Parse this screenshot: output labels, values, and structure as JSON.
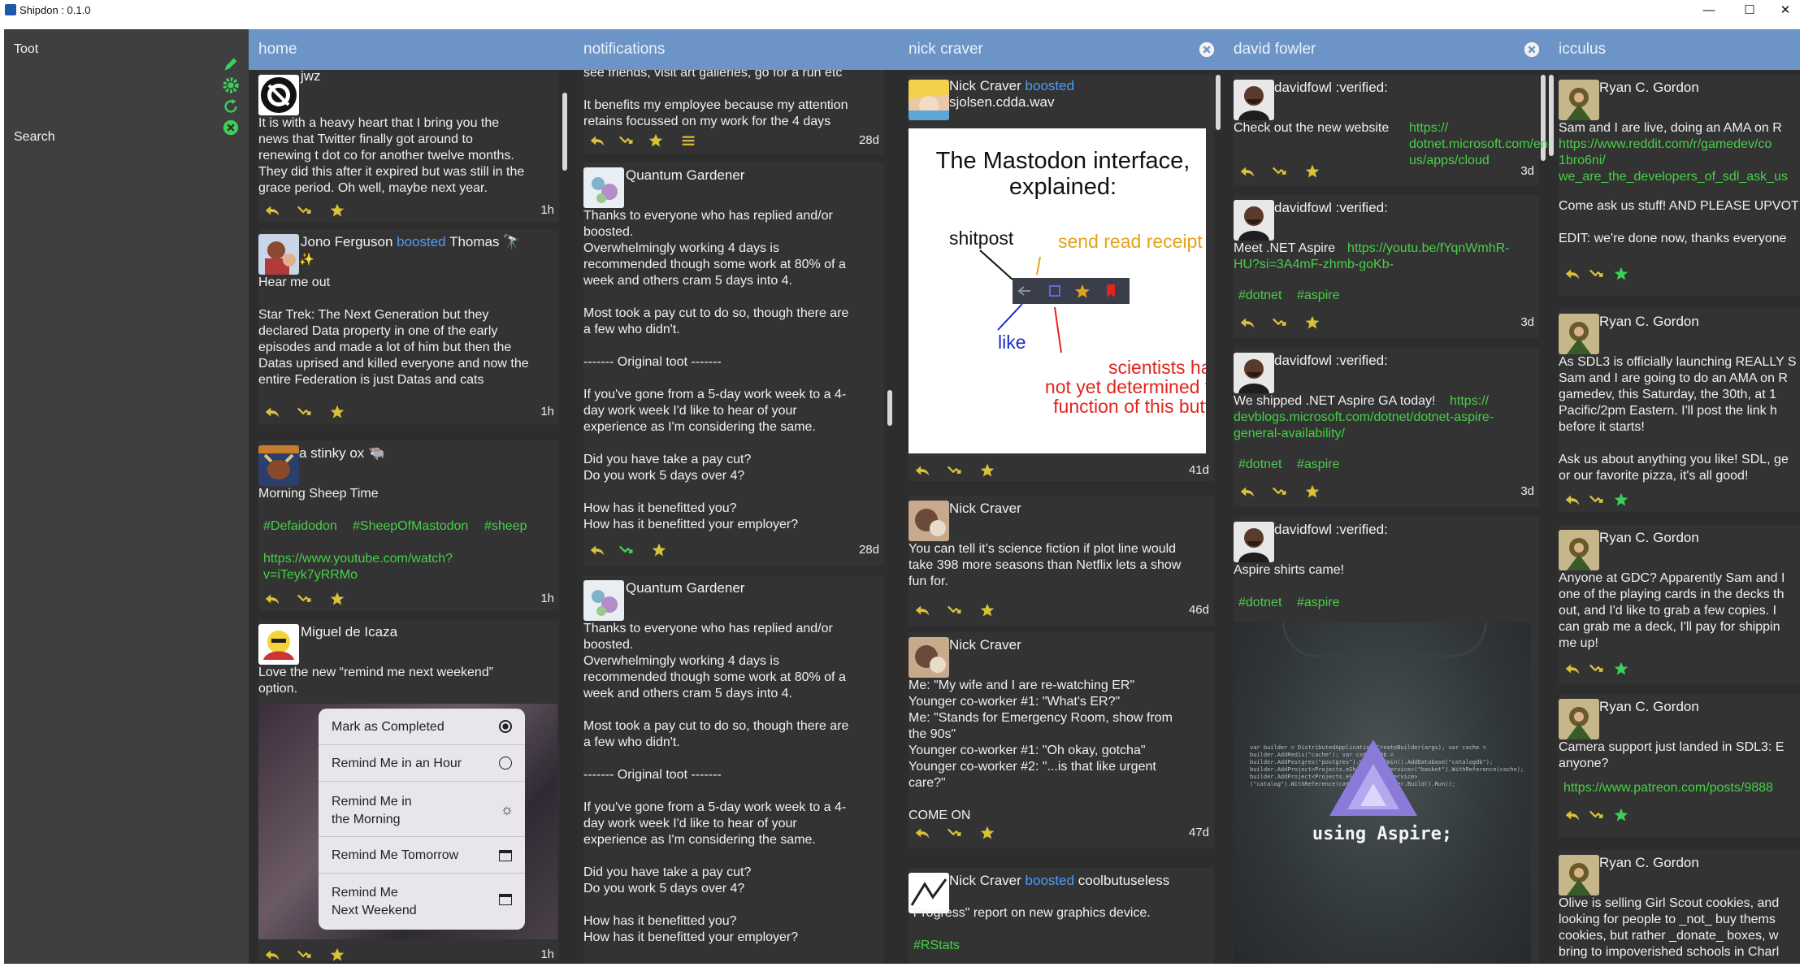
{
  "window": {
    "title": "Shipdon : 0.1.0",
    "minimize": "—",
    "maximize": "☐",
    "close": "✕"
  },
  "sidebar": {
    "toot_label": "Toot",
    "search_label": "Search"
  },
  "columns": {
    "home": {
      "title": "home",
      "p1": {
        "author": "jwz",
        "text": "It is with a heavy heart that I bring you the\nnews that Twitter finally got around to\nrenewing t dot co for another twelve months.\nThey did this after it expired but was still in the\ngrace period. Oh well, maybe next year.",
        "age": "1h"
      },
      "p2": {
        "author": "Jono Ferguson",
        "boosted": "boosted",
        "booster": "Thomas 🔭",
        "sparkle": "✨",
        "text1": "Hear me out",
        "text2": "Star Trek: The Next Generation but they\ndeclared Data property in one of the early\nepisodes and made a lot of him but then the\nDatas uprised and killed everyone and now the\nentire Federation is just Datas and cats",
        "age": "1h"
      },
      "p3": {
        "author": "a stinky ox 🐃",
        "text": "Morning Sheep Time",
        "tag1": "#Defaidodon",
        "tag2": "#SheepOfMastodon",
        "tag3": "#sheep",
        "link": "https://www.youtube.com/watch?\nv=iTeyk7yRRMo",
        "age": "1h"
      },
      "p4": {
        "author": "Miguel de Icaza",
        "text": "Love the new “remind me next weekend”\noption.",
        "age": "1h",
        "menu": [
          "Mark as Completed",
          "Remind Me in an Hour",
          "Remind Me in\nthe Morning",
          "Remind Me Tomorrow",
          "Remind Me\nNext Weekend"
        ]
      }
    },
    "notifications": {
      "title": "notifications",
      "n1": {
        "text": "see friends, visit art galleries, go for a run etc\n\nIt benefits my employee because my attention\nretains focussed on my work for the 4 days",
        "age": "28d"
      },
      "n2": {
        "author": "Quantum Gardener",
        "text": "Thanks to everyone who has replied and/or\nboosted.\nOverwhelmingly working 4 days is\nrecommended though some work at 80% of a\nweek and others cram 5 days into 4.\n\nMost took a pay cut to do so, though there are\na few who didn't.\n\n------- Original toot -------\n\nIf you've gone from a 5-day work week to a 4-\nday work week I'd like to hear of your\nexperience as I'm considering the same.\n\nDid you have take a pay cut?\nDo you work 5 days over 4?\n\nHow has it benefitted you?\nHow has it benefitted your employer?",
        "age": "28d"
      },
      "n3": {
        "author": "Quantum Gardener",
        "text": "Thanks to everyone who has replied and/or\nboosted.\nOverwhelmingly working 4 days is\nrecommended though some work at 80% of a\nweek and others cram 5 days into 4.\n\nMost took a pay cut to do so, though there are\na few who didn't.\n\n------- Original toot -------\n\nIf you've gone from a 5-day work week to a 4-\nday work week I'd like to hear of your\nexperience as I'm considering the same.\n\nDid you have take a pay cut?\nDo you work 5 days over 4?\n\nHow has it benefitted you?\nHow has it benefitted your employer?"
      }
    },
    "nick": {
      "title": "nick craver",
      "c1": {
        "author": "Nick Craver",
        "boosted": "boosted",
        "booster": "sjolsen.cdda.wav",
        "age": "41d",
        "img": {
          "title": "The Mastodon interface,\nexplained:",
          "shitpost": "shitpost",
          "send": "send read receipt",
          "like": "like",
          "sci": "scientists hav\nnot yet determined th\nfunction of this butto"
        }
      },
      "c2": {
        "author": "Nick Craver",
        "text": "You can tell it’s science fiction if plot line would\ntake 398 more seasons than Netflix lets a show\nfun for.",
        "age": "46d"
      },
      "c3": {
        "author": "Nick Craver",
        "text": "Me: \"My wife and I are re-watching ER\"\nYounger co-worker #1: \"What's ER?\"\nMe: \"Stands for Emergency Room, show from\nthe 90s\"\nYounger co-worker #1: \"Oh okay, gotcha\"\nYounger co-worker #2: \"...is that like urgent\ncare?\"\n\nCOME ON",
        "age": "47d"
      },
      "c4": {
        "author": "Nick Craver",
        "boosted": "boosted",
        "booster": "coolbutuseless",
        "text": "\"Progress\" report on new graphics device.",
        "tag": "#RStats"
      }
    },
    "david": {
      "title": "david fowler",
      "d1": {
        "author": "davidfowl :verified:",
        "text": "Check out the new website",
        "link": "https://\ndotnet.microsoft.com/en-us/apps/cloud",
        "age": "3d"
      },
      "d2": {
        "author": "davidfowl :verified:",
        "text": "Meet .NET Aspire",
        "link": "https://youtu.be/fYqnWmhR-\nHU?si=3A4mF-zhmb-goKb-",
        "tag1": "#dotnet",
        "tag2": "#aspire",
        "age": "3d"
      },
      "d3": {
        "author": "davidfowl :verified:",
        "text": "We shipped .NET Aspire GA today!",
        "link": "https://\ndevblogs.microsoft.com/dotnet/dotnet-aspire-\ngeneral-availability/",
        "tag1": "#dotnet",
        "tag2": "#aspire",
        "age": "3d"
      },
      "d4": {
        "author": "davidfowl :verified:",
        "text": "Aspire shirts came!",
        "tag1": "#dotnet",
        "tag2": "#aspire",
        "shirt_text": "using Aspire;"
      }
    },
    "icculus": {
      "title": "icculus",
      "i1": {
        "author": "Ryan C. Gordon",
        "text": "Sam and I are live, doing an AMA on R",
        "link": "https://www.reddit.com/r/gamedev/co\n1bro6ni/\nwe_are_the_developers_of_sdl_ask_us",
        "text2": "Come ask us stuff! AND PLEASE UPVOT\n\nEDIT: we're done now, thanks everyone"
      },
      "i2": {
        "author": "Ryan C. Gordon",
        "text": "As SDL3 is officially launching REALLY S\nSam and I are going to do an AMA on R\ngamedev, this Saturday, the 30th, at 1\nPacific/2pm Eastern. I'll post the link h\nbefore it starts!\n\nAsk us about anything you like! SDL, ge\nor our favorite pizza, it's all good!"
      },
      "i3": {
        "author": "Ryan C. Gordon",
        "text": "Anyone at GDC? Apparently Sam and I\none of the playing cards in the decks th\nout, and I'd like to grab a few copies. I\ncan grab me a deck, I'll pay for shippin\nme up!"
      },
      "i4": {
        "author": "Ryan C. Gordon",
        "text": "Camera support just landed in SDL3: E\nanyone?",
        "link": "https://www.patreon.com/posts/9888"
      },
      "i5": {
        "author": "Ryan C. Gordon",
        "text": "Olive is selling Girl Scout cookies, and\nlooking for people to _not_ buy thems\ncookies, but rather _donate_ boxes, w\nbring to impoverished schools in Charl"
      }
    }
  },
  "icons": [
    "reply-icon",
    "boost-icon",
    "favourite-icon",
    "more-icon",
    "close-icon",
    "pencil-icon",
    "gear-icon",
    "refresh-icon",
    "close-circle-icon"
  ],
  "colors": {
    "header": "#6c94c7",
    "column_bg": "#2d2d2d",
    "post_bg": "#333333",
    "tag": "#46d146",
    "boosted": "#4f9cf6",
    "action_yellow": "#d8c23a",
    "action_green": "#3ecf5a"
  }
}
